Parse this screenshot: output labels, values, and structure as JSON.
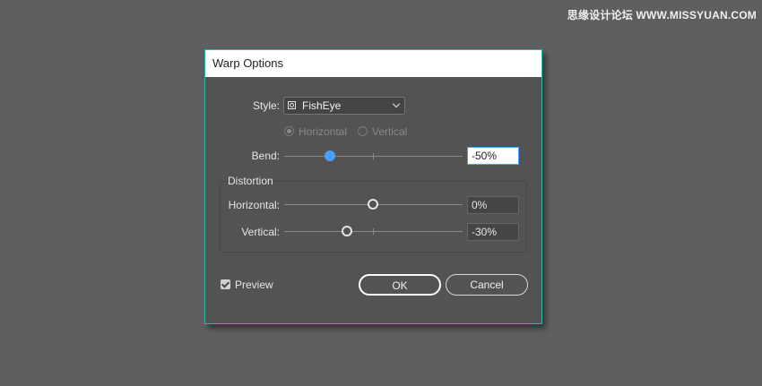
{
  "watermark": "思缘设计论坛 WWW.MISSYUAN.COM",
  "dialog": {
    "title": "Warp Options",
    "style_label": "Style:",
    "style_value": "FishEye",
    "style_icon": "warp-style-icon",
    "orientation": {
      "horizontal_label": "Horizontal",
      "vertical_label": "Vertical",
      "selected": "Horizontal"
    },
    "bend_label": "Bend:",
    "bend_value": "-50%",
    "distortion": {
      "title": "Distortion",
      "horizontal_label": "Horizontal:",
      "horizontal_value": "0%",
      "vertical_label": "Vertical:",
      "vertical_value": "-30%"
    },
    "preview_label": "Preview",
    "preview_checked": true,
    "ok_label": "OK",
    "cancel_label": "Cancel"
  }
}
